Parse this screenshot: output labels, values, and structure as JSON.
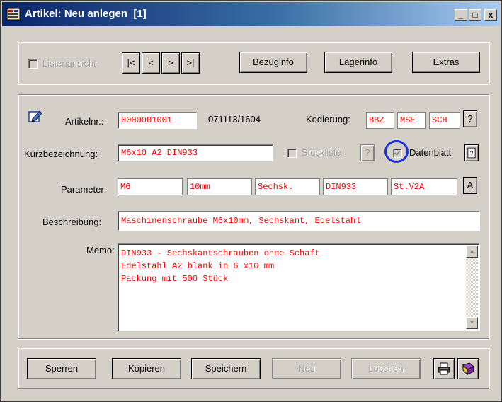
{
  "window": {
    "title": "Artikel: Neu anlegen  [1]",
    "minimize": "_",
    "maximize": "□",
    "close": "x"
  },
  "toolbar": {
    "list_view_label": "Listenansicht",
    "nav_first": "|<",
    "nav_prev": "<",
    "nav_next": ">",
    "nav_last": ">|",
    "bezuginfo": "Bezuginfo",
    "lagerinfo": "Lagerinfo",
    "extras": "Extras"
  },
  "form": {
    "artikelnr_label": "Artikelnr.:",
    "artikelnr_value": "0000001001",
    "artikel_info": "071113/1604",
    "kodierung_label": "Kodierung:",
    "kodierung_values": [
      "BBZ",
      "MSE",
      "SCH"
    ],
    "kodierung_help": "?",
    "kurzbezeichnung_label": "Kurzbezeichnung:",
    "kurzbezeichnung_value": "M6x10 A2 DIN933",
    "stueckliste_label": "Stückliste",
    "stueckliste_help": "?",
    "datenblatt_label": "Datenblatt",
    "parameter_label": "Parameter:",
    "parameters": [
      "M6",
      "10mm",
      "Sechsk.",
      "DIN933",
      "St.V2A"
    ],
    "parameter_btn": "A",
    "beschreibung_label": "Beschreibung:",
    "beschreibung_value": "Maschinenschraube M6x10mm, Sechskant, Edelstahl",
    "memo_label": "Memo:",
    "memo_lines": [
      "DIN933 - Sechskantschrauben ohne Schaft",
      "Edelstahl A2 blank in 6 x10 mm",
      "Packung mit 500 Stück"
    ]
  },
  "footer": {
    "sperren": "Sperren",
    "kopieren": "Kopieren",
    "speichern": "Speichern",
    "neu": "Neu",
    "loeschen": "Löschen"
  },
  "colors": {
    "field_text": "#ff0000",
    "highlight_circle": "#1a30e0",
    "title_gradient_start": "#0a246a"
  }
}
